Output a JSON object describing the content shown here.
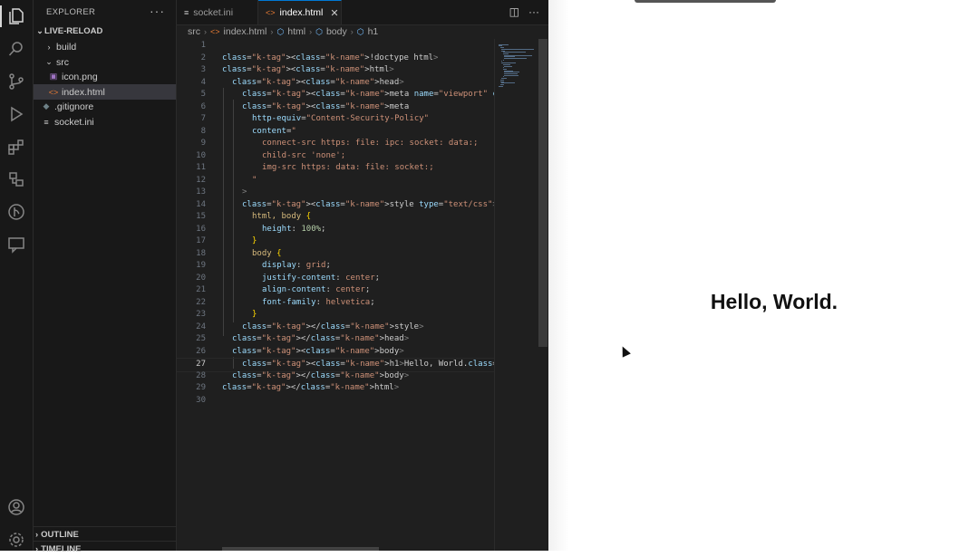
{
  "sidebar": {
    "title": "EXPLORER",
    "more": "···",
    "root": "LIVE-RELOAD",
    "items": [
      {
        "label": "build",
        "type": "folder"
      },
      {
        "label": "src",
        "type": "folder"
      },
      {
        "label": "icon.png",
        "type": "image"
      },
      {
        "label": "index.html",
        "type": "html"
      },
      {
        "label": ".gitignore",
        "type": "git"
      },
      {
        "label": "socket.ini",
        "type": "ini"
      }
    ],
    "outline": "OUTLINE",
    "timeline": "TIMELINE"
  },
  "tabs": [
    {
      "label": "socket.ini",
      "icon": "≡"
    },
    {
      "label": "index.html",
      "icon": "<>",
      "close": "✕"
    }
  ],
  "breadcrumb": [
    "src",
    "index.html",
    "html",
    "body",
    "h1"
  ],
  "code": {
    "lines": [
      "",
      "<!doctype html>",
      "<html>",
      "<head>",
      "<meta name=\"viewport\" content=\"width=device-width, i",
      "<meta",
      "http-equiv=\"Content-Security-Policy\"",
      "content=\"",
      "connect-src https: file: ipc: socket: data:;",
      "child-src 'none';",
      "img-src https: data: file: socket:;",
      "\"",
      ">",
      "<style type=\"text/css\">",
      "html, body {",
      "height: 100%;",
      "}",
      "body {",
      "display: grid;",
      "justify-content: center;",
      "align-content: center;",
      "font-family: helvetica;",
      "}",
      "</style>",
      "</head>",
      "<body>",
      "<h1>Hello, World.</h1>",
      "</body>",
      "</html>",
      ""
    ],
    "current_line": 27
  },
  "preview": {
    "heading": "Hello, World."
  }
}
